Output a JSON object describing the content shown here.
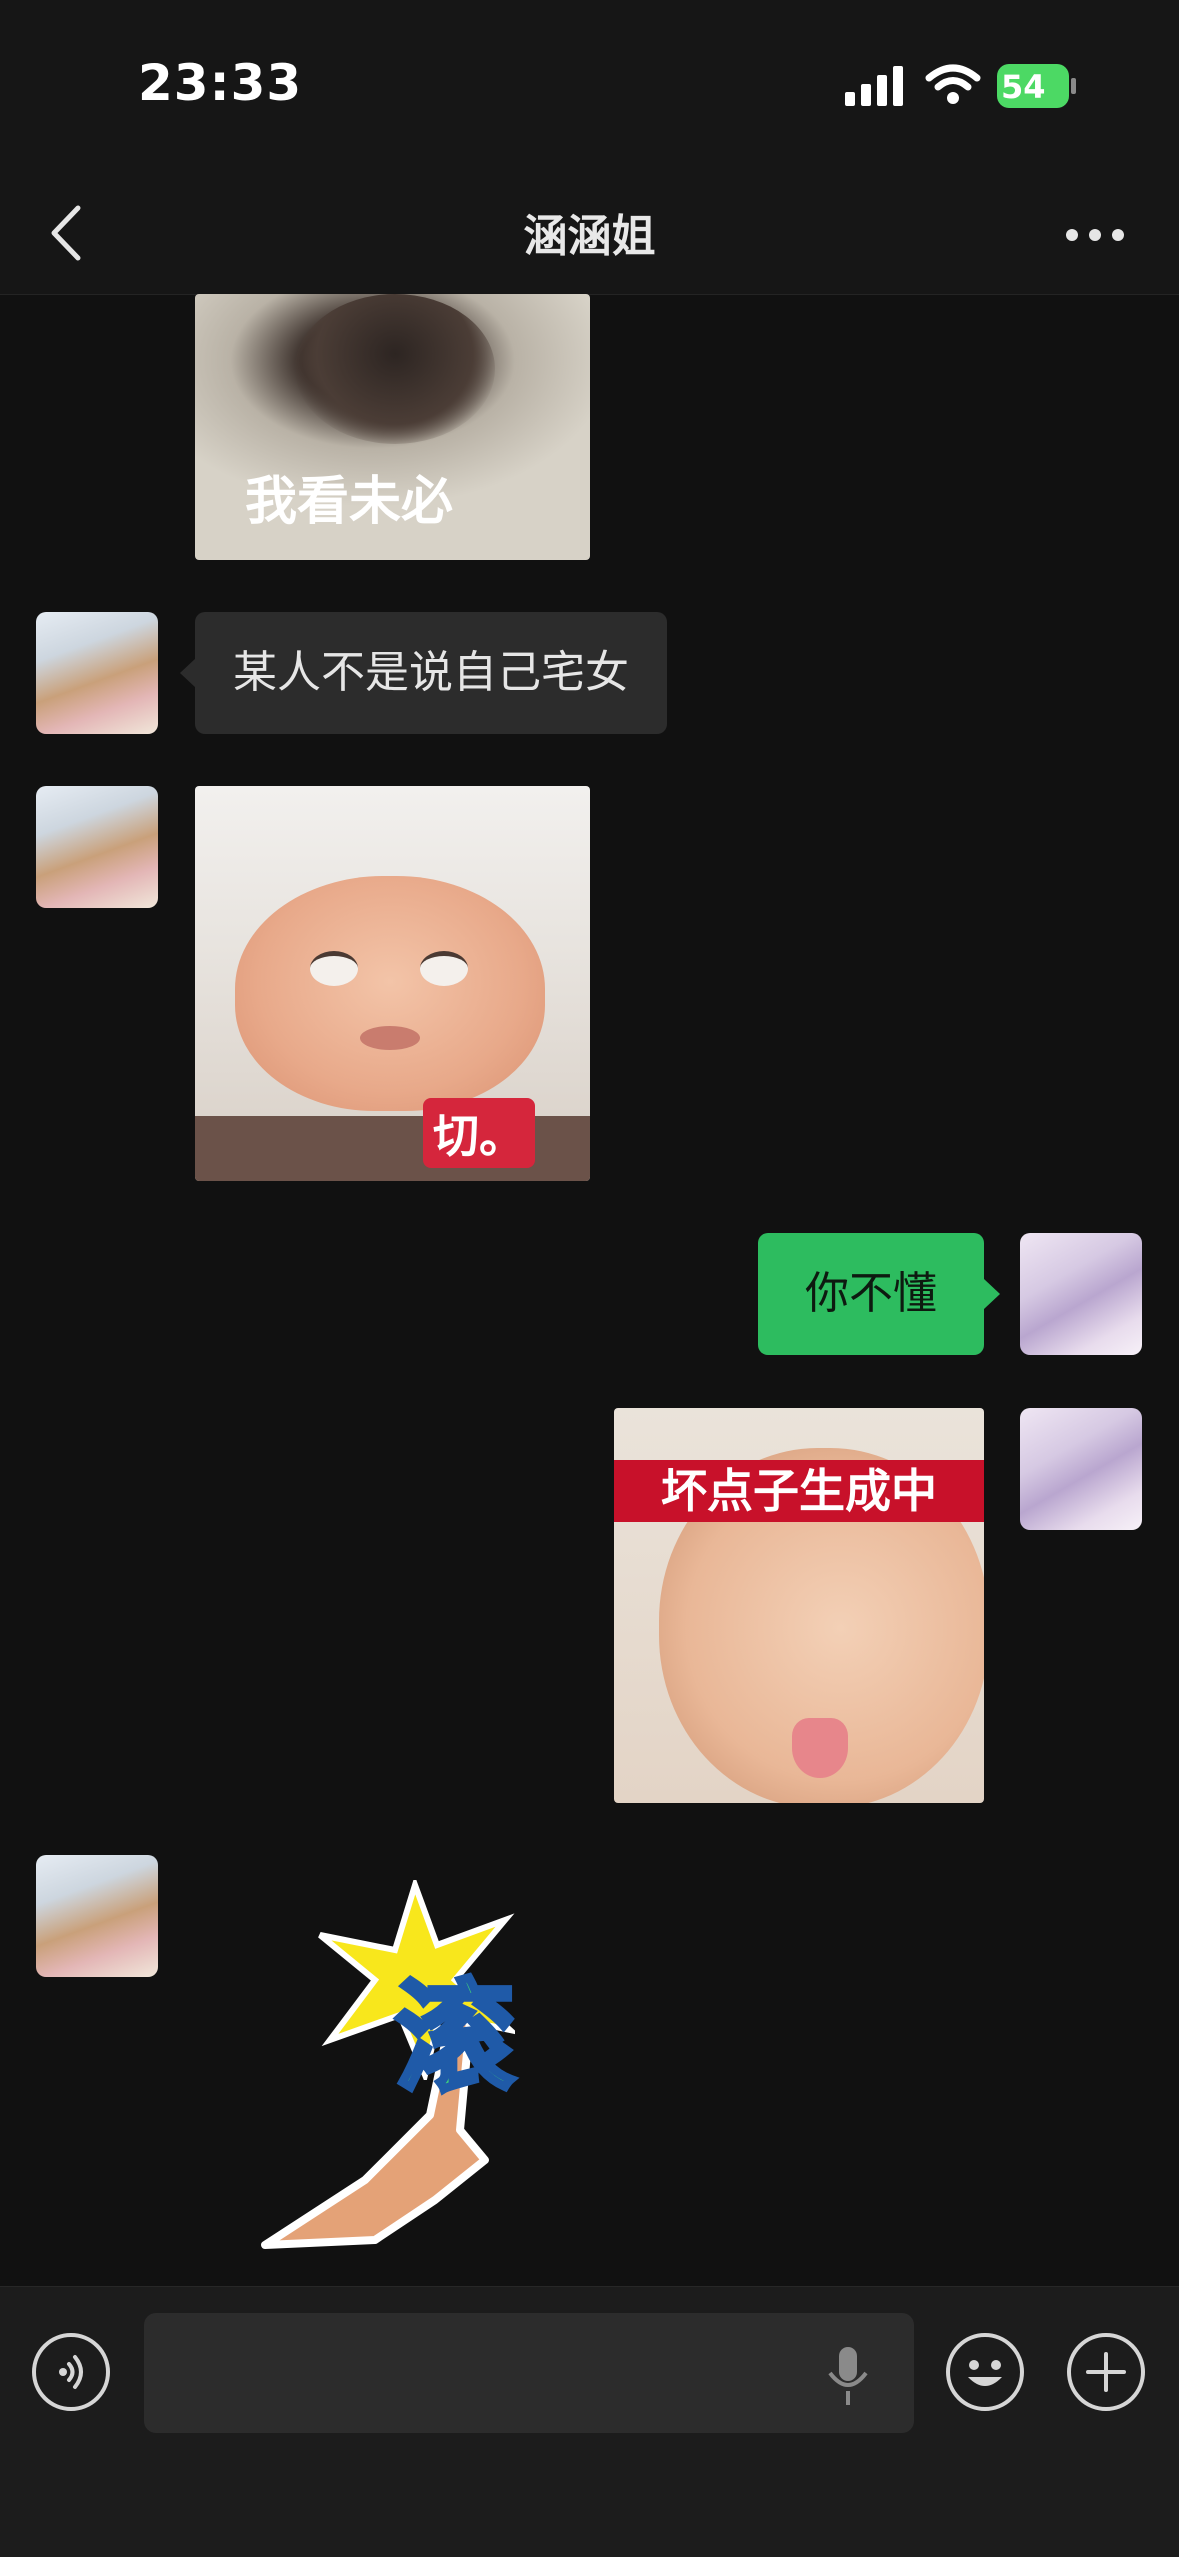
{
  "status_bar": {
    "time": "23:33",
    "battery_level": "54",
    "icons": [
      "cellular-signal-icon",
      "wifi-icon",
      "battery-charging-icon"
    ]
  },
  "nav_bar": {
    "title": "涵涵姐",
    "back_icon": "chevron-left-icon",
    "more_icon": "more-dots-icon"
  },
  "messages": [
    {
      "sender": "contact",
      "type": "sticker",
      "caption": "我看未必"
    },
    {
      "sender": "contact",
      "type": "text",
      "text": "某人不是说自己宅女"
    },
    {
      "sender": "contact",
      "type": "sticker",
      "caption": "切。"
    },
    {
      "sender": "me",
      "type": "text",
      "text": "你不懂"
    },
    {
      "sender": "me",
      "type": "sticker",
      "caption": "坏点子生成中"
    },
    {
      "sender": "contact",
      "type": "sticker",
      "caption": "滚"
    }
  ],
  "input_bar": {
    "voice_icon": "voice-mode-icon",
    "mic_icon": "microphone-icon",
    "emoji_icon": "emoji-icon",
    "plus_icon": "plus-icon"
  },
  "colors": {
    "background": "#111111",
    "incoming_bubble": "#2c2c2c",
    "outgoing_bubble": "#2dbc5f",
    "battery": "#4cd964"
  }
}
